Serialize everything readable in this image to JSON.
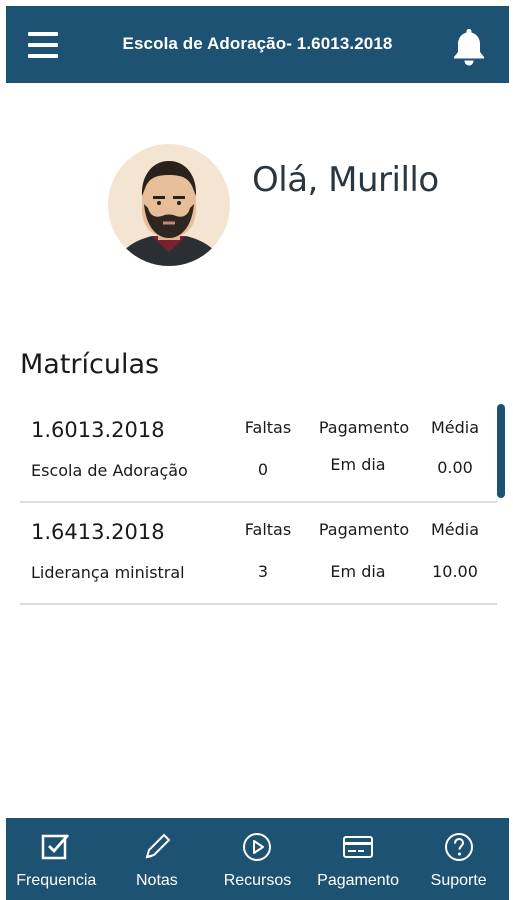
{
  "header": {
    "title": "Escola de Adoração- 1.6013.2018",
    "menu_icon": "hamburger-menu-icon",
    "notification_icon": "bell-icon"
  },
  "profile": {
    "greeting": "Olá, Murillo",
    "avatar_icon": "bearded-man-avatar"
  },
  "enrollments": {
    "title": "Matrículas",
    "columns": {
      "absences": "Faltas",
      "payment": "Pagamento",
      "average": "Média"
    },
    "items": [
      {
        "code": "1.6013.2018",
        "course": "Escola de Adoração",
        "absences": "0",
        "payment": "Em dia",
        "average": "0.00"
      },
      {
        "code": "1.6413.2018",
        "course": "Liderança ministral",
        "absences": "3",
        "payment": "Em dia",
        "average": "10.00"
      }
    ]
  },
  "tabbar": {
    "items": [
      {
        "label": "Frequencia",
        "icon": "checkbox-icon"
      },
      {
        "label": "Notas",
        "icon": "pencil-icon"
      },
      {
        "label": "Recursos",
        "icon": "play-circle-icon"
      },
      {
        "label": "Pagamento",
        "icon": "credit-card-icon"
      },
      {
        "label": "Suporte",
        "icon": "help-circle-icon"
      }
    ]
  },
  "colors": {
    "primary": "#1e5273",
    "background": "#ffffff",
    "divider": "#dcdcdc"
  }
}
